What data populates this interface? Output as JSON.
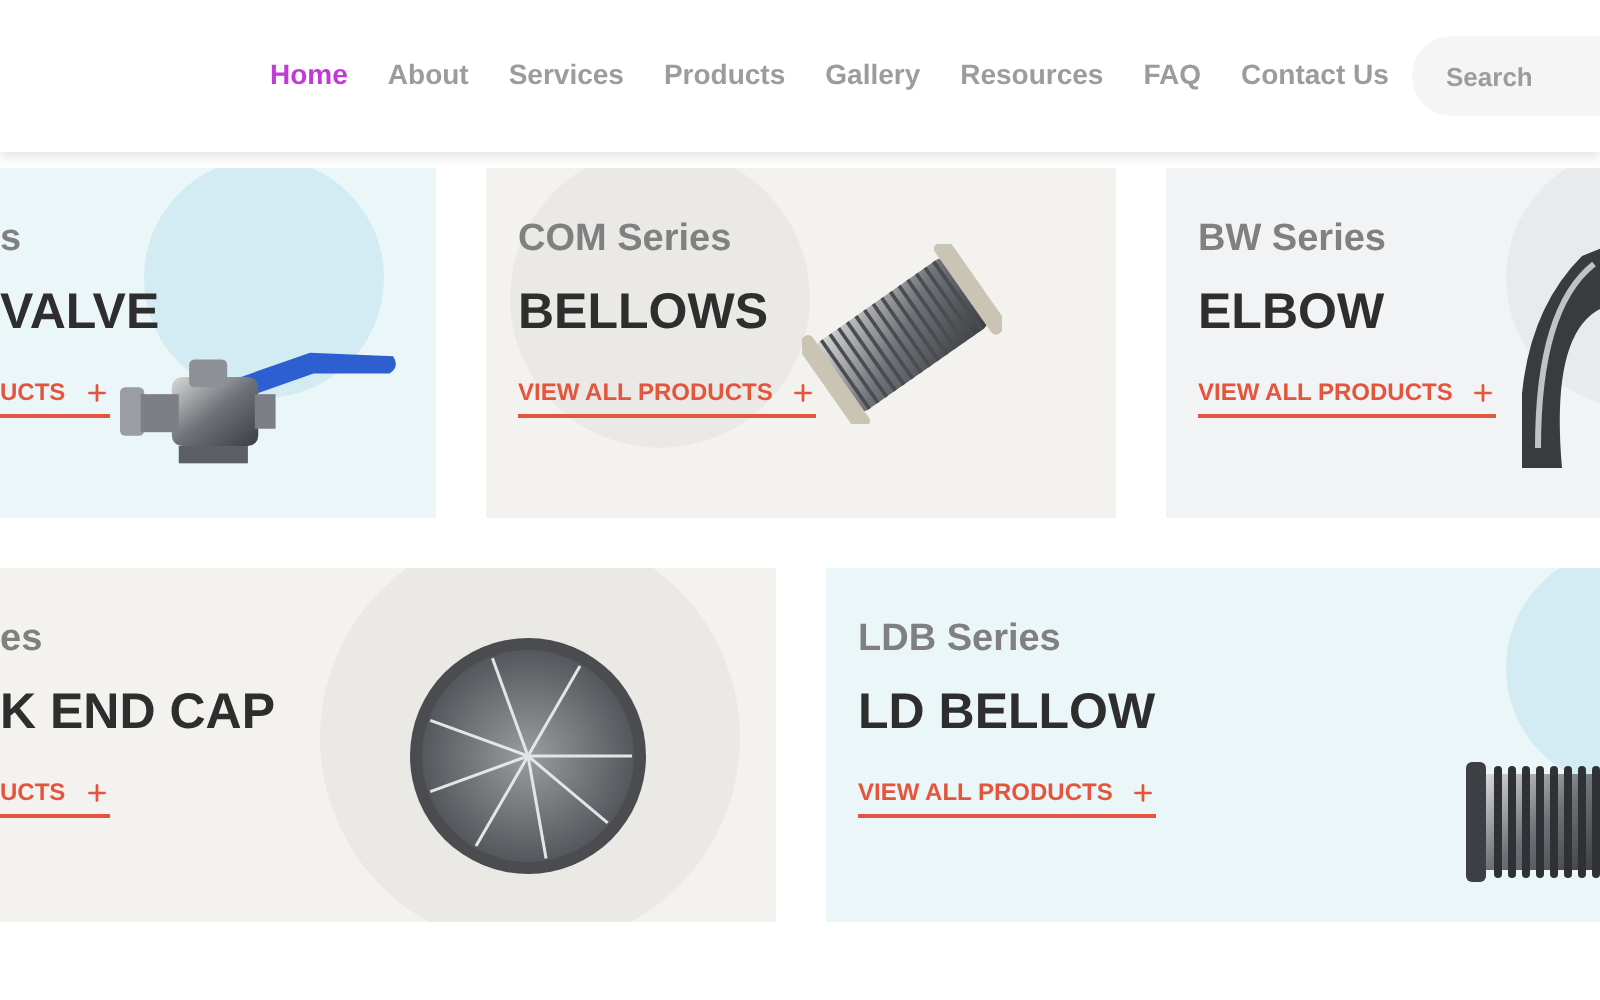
{
  "nav": {
    "items": [
      {
        "label": "Home",
        "selected": true
      },
      {
        "label": "About",
        "selected": false
      },
      {
        "label": "Services",
        "selected": false
      },
      {
        "label": "Products",
        "selected": false
      },
      {
        "label": "Gallery",
        "selected": false
      },
      {
        "label": "Resources",
        "selected": false
      },
      {
        "label": "FAQ",
        "selected": false
      },
      {
        "label": "Contact Us",
        "selected": false
      }
    ]
  },
  "search": {
    "placeholder": "Search"
  },
  "rows": [
    {
      "cards": [
        {
          "series": "s",
          "title": "VALVE",
          "link": "UCTS",
          "kind": "valve",
          "color": "#ebf6f8"
        },
        {
          "series": "COM Series",
          "title": "BELLOWS",
          "link": "VIEW ALL PRODUCTS",
          "kind": "bellows",
          "color": "#f3f2ef"
        },
        {
          "series": "BW Series",
          "title": "ELBOW",
          "link": "VIEW ALL PRODUCTS",
          "kind": "elbow",
          "color": "#f2f3f5"
        }
      ]
    },
    {
      "cards": [
        {
          "series": "es",
          "title": "K END CAP",
          "link": "UCTS",
          "kind": "endcap",
          "color": "#f3f2ef"
        },
        {
          "series": "LDB Series",
          "title": "LD BELLOW",
          "link": "VIEW ALL PRODUCTS",
          "kind": "bellow",
          "color": "#ebf6f8"
        }
      ]
    }
  ]
}
